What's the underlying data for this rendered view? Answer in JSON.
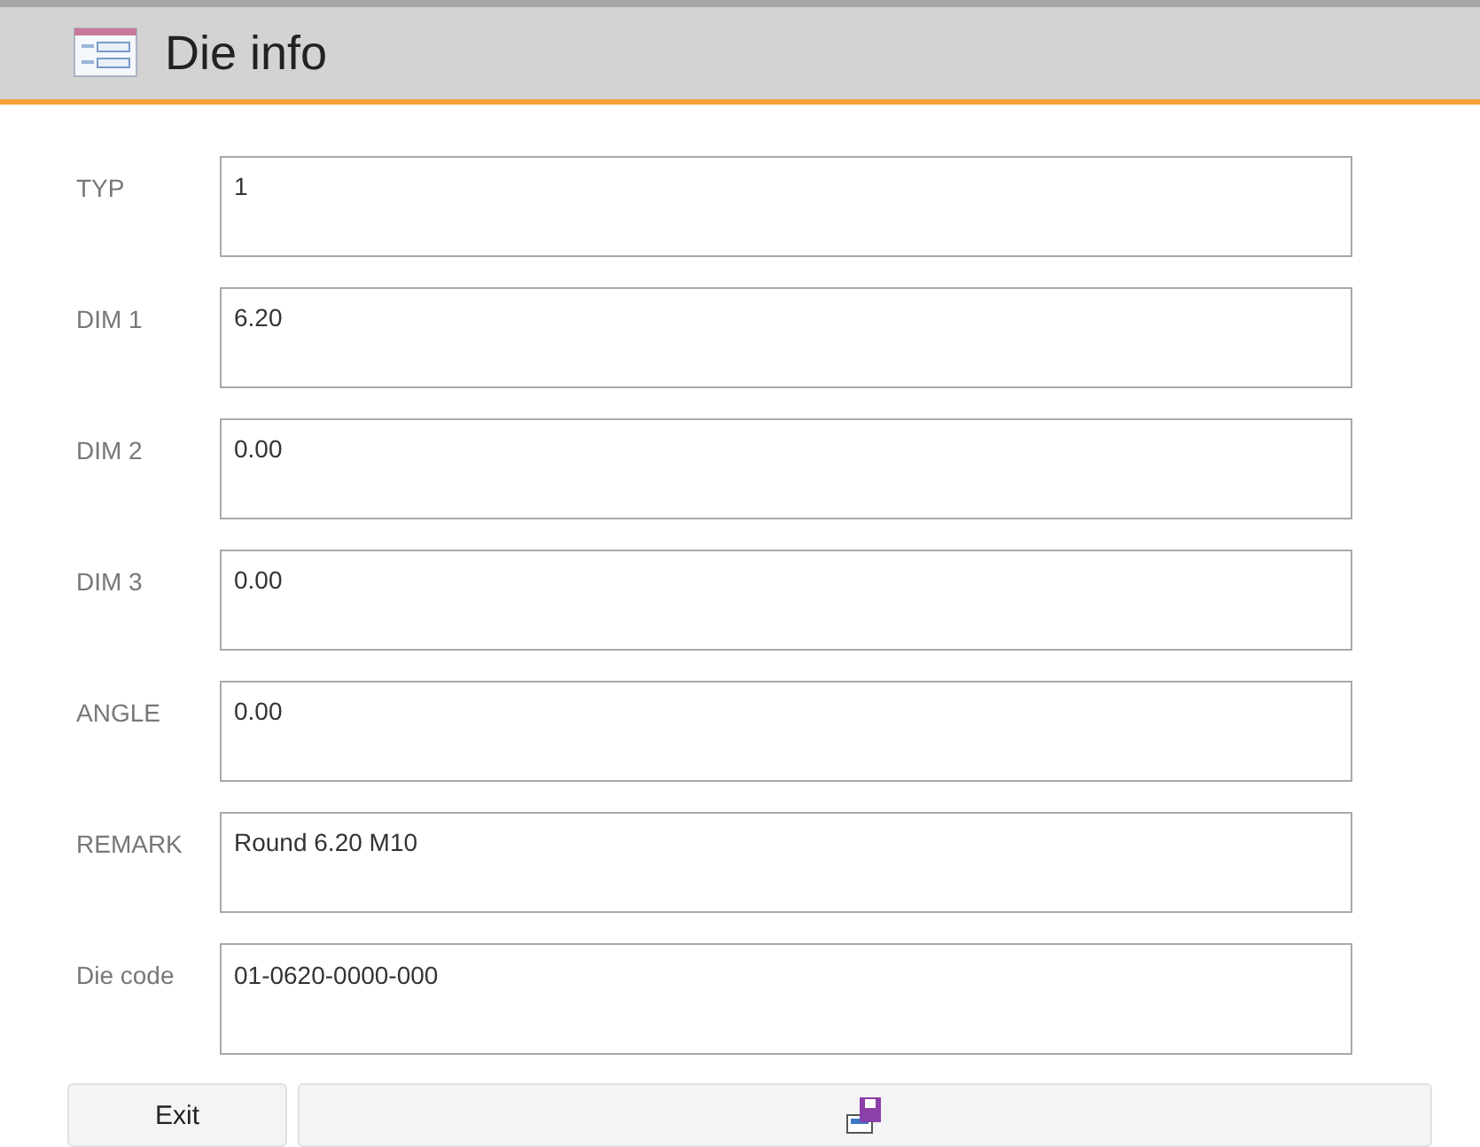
{
  "header": {
    "title": "Die info"
  },
  "fields": [
    {
      "label": "TYP",
      "value": "1"
    },
    {
      "label": "DIM 1",
      "value": "6.20"
    },
    {
      "label": "DIM 2",
      "value": "0.00"
    },
    {
      "label": "DIM 3",
      "value": "0.00"
    },
    {
      "label": "ANGLE",
      "value": "0.00"
    },
    {
      "label": "REMARK",
      "value": "Round 6.20 M10"
    },
    {
      "label": "Die code",
      "value": "01-0620-0000-000"
    }
  ],
  "buttons": [
    {
      "kind": "text",
      "label": "Exit"
    },
    {
      "kind": "save-icon"
    }
  ]
}
